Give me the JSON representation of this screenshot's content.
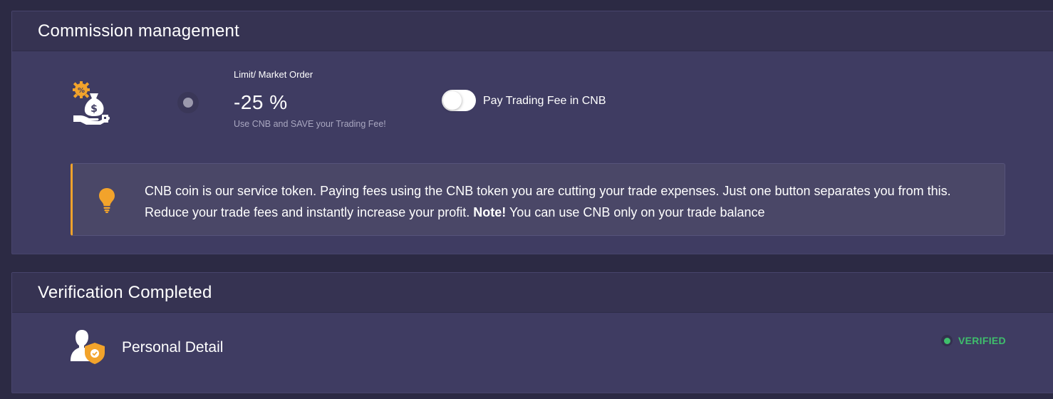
{
  "colors": {
    "page_bg": "#2c2a44",
    "card_bg": "#3f3c62",
    "header_bg": "#363352",
    "accent_orange": "#f2a32b",
    "verified_green": "#3fbf6c"
  },
  "commission": {
    "title": "Commission management",
    "icon": "money-bag-discount-icon",
    "order_type_label": "Limit/ Market Order",
    "discount_value": "-25 %",
    "discount_hint": "Use CNB and SAVE your Trading Fee!",
    "toggle": {
      "label": "Pay Trading Fee in CNB",
      "enabled": false
    },
    "note": {
      "icon": "lightbulb-icon",
      "text_part1": "CNB coin is our service token. Paying fees using the CNB token you are cutting your trade expenses. Just one button separates you from this. Reduce your trade fees and instantly increase your profit.",
      "emphasis": "Note!",
      "text_part2": "You can use CNB only on your trade balance"
    }
  },
  "verification": {
    "title": "Verification Completed",
    "items": [
      {
        "icon": "user-shield-icon",
        "label": "Personal Detail",
        "status": "VERIFIED"
      }
    ]
  }
}
